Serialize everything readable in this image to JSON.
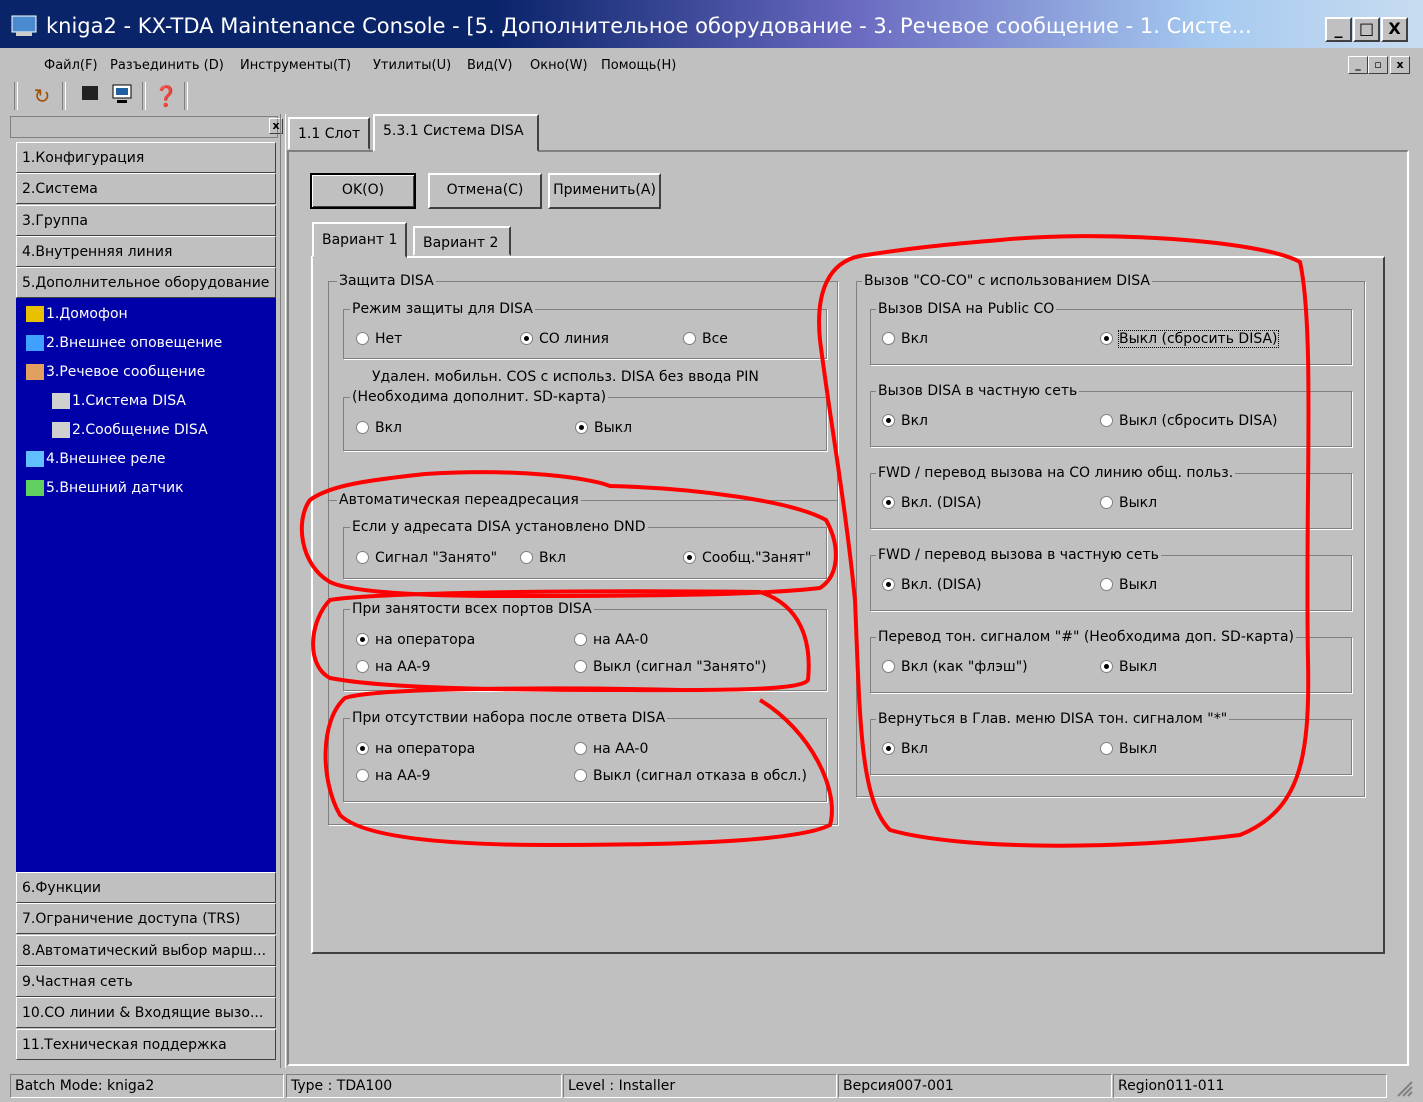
{
  "window": {
    "title": "kniga2 - KX-TDA Maintenance Console - [5. Дополнительное оборудование - 3. Речевое сообщение - 1. Систе...",
    "btn_min": "_",
    "btn_max": "□",
    "btn_close": "X"
  },
  "menu": {
    "items": [
      "Файл(F)",
      "Разъединить (D)",
      "Инструменты(T)",
      "Утилиты(U)",
      "Вид(V)",
      "Окно(W)",
      "Помощь(H)"
    ],
    "mdi_min": "_",
    "mdi_restore": "▫",
    "mdi_close": "x"
  },
  "nav": {
    "collapse": "x",
    "items_top": [
      "1.Конфигурация",
      "2.Система",
      "3.Группа",
      "4.Внутренняя линия",
      "5.Дополнительное оборудование"
    ],
    "tree": [
      "1.Домофон",
      "2.Внешнее оповещение",
      "3.Речевое сообщение",
      "1.Система DISA",
      "2.Сообщение DISA",
      "4.Внешнее реле",
      "5.Внешний датчик"
    ],
    "items_bottom": [
      "6.Функции",
      "7.Ограничение доступа (TRS)",
      "8.Автоматический выбор марш...",
      "9.Частная сеть",
      "10.CO линии & Входящие вызо...",
      "11.Техническая поддержка"
    ]
  },
  "tabs": {
    "slot": "1.1 Слот",
    "disa": "5.3.1 Система DISA"
  },
  "buttons": {
    "ok": "OK(O)",
    "cancel": "Отмена(C)",
    "apply": "Применить(A)"
  },
  "subtabs": {
    "v1": "Вариант 1",
    "v2": "Вариант 2"
  },
  "left": {
    "protection_title": "Защита DISA",
    "mode_title": "Режим защиты для DISA",
    "mode_opts": [
      "Нет",
      "CO линия",
      "Все"
    ],
    "mode_selected": "CO линия",
    "mobile_line1": "Удален. мобильн. COS с использ. DISA без ввода PIN",
    "mobile_line2": "(Необходима дополнит. SD-карта)",
    "mobile_opts": [
      "Вкл",
      "Выкл"
    ],
    "mobile_selected": "Выкл",
    "auto_title": "Автоматическая переадресация",
    "dnd_title": "Если у адресата DISA установлено DND",
    "dnd_opts": [
      "Сигнал \"Занято\"",
      "Вкл",
      "Сообщ.\"Занят\""
    ],
    "dnd_selected": "Сообщ.\"Занят\"",
    "busy_title": "При занятости всех портов DISA",
    "busy_opts": [
      "на оператора",
      "на AA-0",
      "на AA-9",
      "Выкл (сигнал \"Занято\")"
    ],
    "busy_selected": "на оператора",
    "nodial_title": "При отсутствии набора после ответа DISA",
    "nodial_opts": [
      "на оператора",
      "на AA-0",
      "на AA-9",
      "Выкл (сигнал отказа в обсл.)"
    ],
    "nodial_selected": "на оператора"
  },
  "right": {
    "coco_title": "Вызов \"CO-CO\" с использованием DISA",
    "public_title": "Вызов DISA на Public CO",
    "public_opts": [
      "Вкл",
      "Выкл (сбросить DISA)"
    ],
    "public_selected": "Выкл (сбросить DISA)",
    "private_title": "Вызов DISA в частную сеть",
    "private_opts": [
      "Вкл",
      "Выкл (сбросить DISA)"
    ],
    "private_selected": "Вкл",
    "fwdco_title": "FWD / перевод вызова на CO линию общ. польз.",
    "fwdco_opts": [
      "Вкл. (DISA)",
      "Выкл"
    ],
    "fwdco_selected": "Вкл. (DISA)",
    "fwdpriv_title": "FWD / перевод вызова в частную сеть",
    "fwdpriv_opts": [
      "Вкл. (DISA)",
      "Выкл"
    ],
    "fwdpriv_selected": "Вкл. (DISA)",
    "hash_title": "Перевод тон. сигналом \"#\" (Необходима доп. SD-карта)",
    "hash_opts": [
      "Вкл (как \"флэш\")",
      "Выкл"
    ],
    "hash_selected": "Выкл",
    "star_title": "Вернуться в Глав. меню DISA тон. сигналом \"*\"",
    "star_opts": [
      "Вкл",
      "Выкл"
    ],
    "star_selected": "Вкл"
  },
  "status": {
    "batch": "Batch Mode: kniga2",
    "type": "Type : TDA100",
    "level": "Level : Installer",
    "version": "Версия007-001",
    "region": "Region011-011"
  },
  "colors": {
    "annotation": "#ff0000",
    "nav_tree_bg": "#0000a8",
    "face": "#c0c0c0"
  }
}
